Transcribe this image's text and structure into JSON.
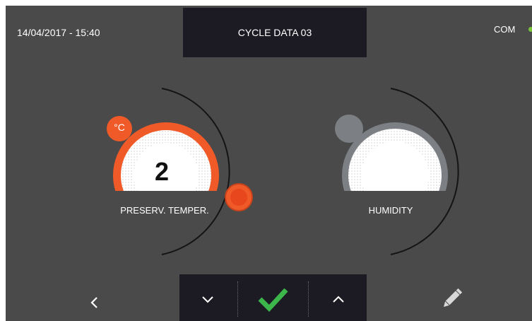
{
  "header": {
    "datetime": "14/04/2017 - 15:40",
    "title": "CYCLE DATA 03",
    "com_label": "COM"
  },
  "dials": {
    "temperature": {
      "label": "PRESERV. TEMPER.",
      "unit": "°C",
      "value": "2"
    },
    "humidity": {
      "label": "HUMIDITY"
    }
  },
  "icons": {
    "back": "chevron-left-icon",
    "down": "chevron-down-icon",
    "confirm": "check-icon",
    "up": "chevron-up-icon",
    "edit": "pencil-icon"
  },
  "colors": {
    "background": "#4a4a4a",
    "panel": "#1c1b23",
    "accent": "#f05a28",
    "check": "#3cb54a",
    "status_ok": "#7cc43a",
    "inactive": "#7c8084"
  }
}
